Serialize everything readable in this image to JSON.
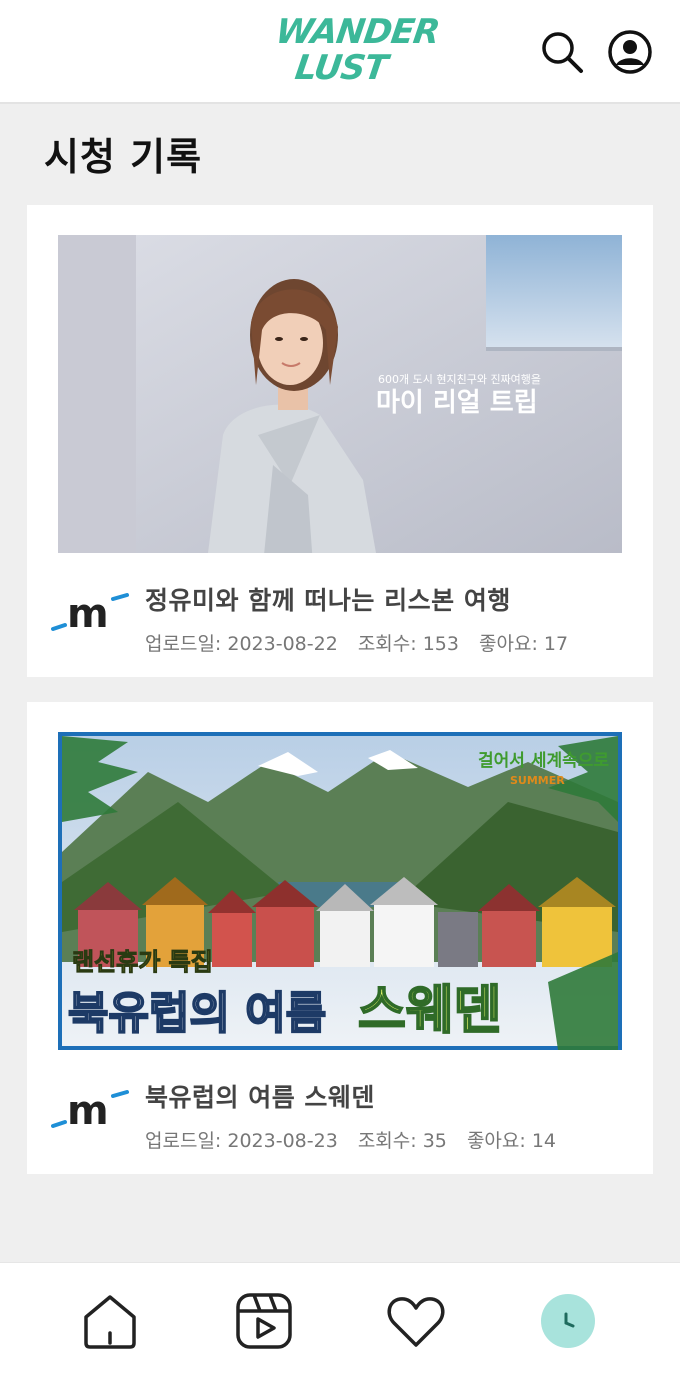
{
  "header": {
    "logo_line1": "WANDER",
    "logo_line2": "LUST",
    "brand_color": "#3cb899",
    "search_icon": "search-icon",
    "profile_icon": "user-circle-icon"
  },
  "page": {
    "title": "시청 기록"
  },
  "videos": [
    {
      "thumbnail_subtitle": "600개 도시 현지친구와 진짜여행을",
      "thumbnail_title": "마이 리얼 트립",
      "title": "정유미와 함께 떠나는 리스본 여행",
      "upload_date": "업로드일: 2023-08-22",
      "views": "조회수: 153",
      "likes": "좋아요: 17",
      "channel_logo": "m"
    },
    {
      "thumbnail_badge": "걸어서 세계속으로",
      "thumbnail_badge_sub": "SUMMER",
      "thumbnail_kicker": "랜선휴가 특집",
      "thumbnail_headline_a": "북유럽의 여름",
      "thumbnail_headline_b": "스웨덴",
      "title": "북유럽의 여름 스웨덴",
      "upload_date": "업로드일: 2023-08-23",
      "views": "조회수: 35",
      "likes": "좋아요: 14",
      "channel_logo": "m"
    }
  ],
  "bottom_nav": {
    "items": [
      {
        "icon": "home-icon"
      },
      {
        "icon": "shorts-play-icon"
      },
      {
        "icon": "heart-icon"
      },
      {
        "icon": "clock-icon",
        "active": true
      }
    ],
    "active_color": "#a8e3dc"
  }
}
